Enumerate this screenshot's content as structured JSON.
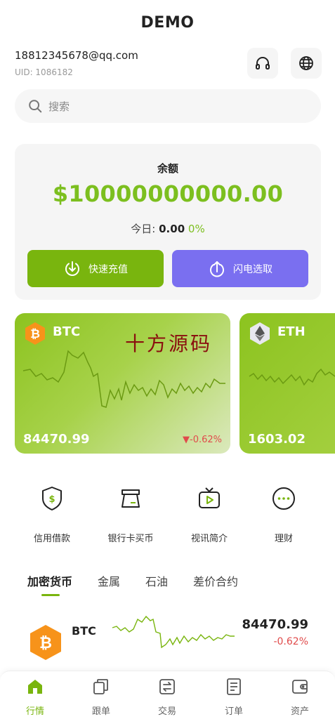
{
  "app": {
    "title": "DEMO"
  },
  "user": {
    "email": "18812345678@qq.com",
    "uid": "UID: 1086182"
  },
  "header_icons": [
    "headphones-icon",
    "globe-icon"
  ],
  "search": {
    "placeholder": "搜索"
  },
  "balance": {
    "label": "余额",
    "amount": "$10000000000.00",
    "today_label": "今日:",
    "today_value": "0.00",
    "today_pct": "0%",
    "deposit_label": "快速充值",
    "withdraw_label": "闪电选取"
  },
  "colors": {
    "accent": "#79b50e",
    "accent_text": "#7cbf1f",
    "purple": "#7a6ff0",
    "down": "#e04b4b"
  },
  "coin_cards": [
    {
      "name": "BTC",
      "price": "84470.99",
      "change": "▼-0.62%",
      "watermark": "十方源码"
    },
    {
      "name": "ETH",
      "price": "1603.02"
    }
  ],
  "quick_actions": [
    {
      "label": "信用借款",
      "icon": "shield-dollar-icon"
    },
    {
      "label": "银行卡买币",
      "icon": "card-terminal-icon"
    },
    {
      "label": "视讯简介",
      "icon": "tv-play-icon"
    },
    {
      "label": "理财",
      "icon": "more-dots-icon"
    }
  ],
  "market_tabs": [
    "加密货币",
    "金属",
    "石油",
    "差价合约"
  ],
  "market_rows": [
    {
      "name": "BTC",
      "price": "84470.99",
      "change": "-0.62%"
    }
  ],
  "nav": [
    {
      "label": "行情",
      "icon": "home-icon",
      "active": true
    },
    {
      "label": "跟单",
      "icon": "copy-icon"
    },
    {
      "label": "交易",
      "icon": "exchange-icon"
    },
    {
      "label": "订单",
      "icon": "order-icon"
    },
    {
      "label": "资产",
      "icon": "wallet-icon"
    }
  ]
}
